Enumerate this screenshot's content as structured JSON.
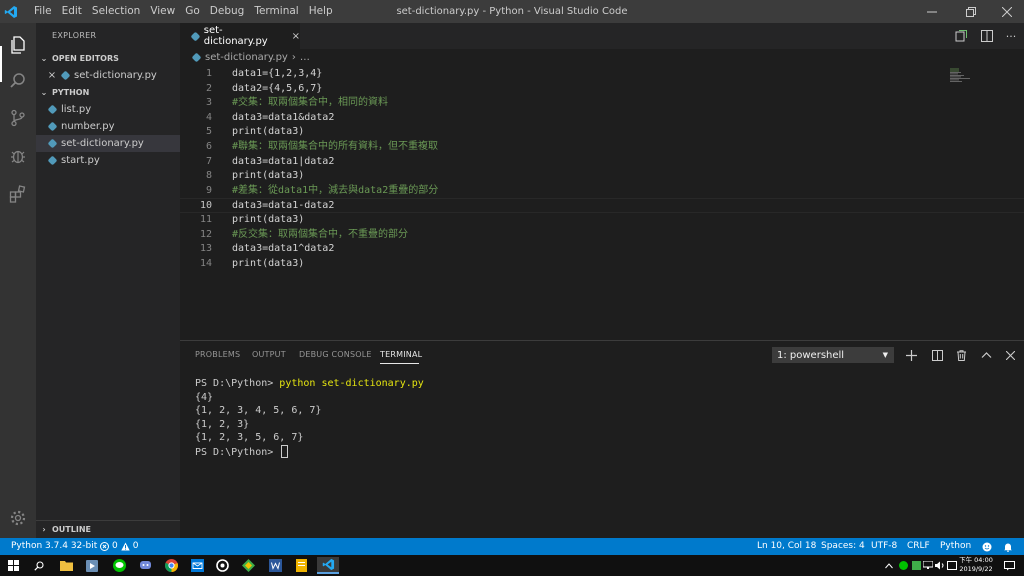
{
  "titlebar": {
    "menu": [
      "File",
      "Edit",
      "Selection",
      "View",
      "Go",
      "Debug",
      "Terminal",
      "Help"
    ],
    "title": "set-dictionary.py - Python - Visual Studio Code"
  },
  "sidebar": {
    "title": "EXPLORER",
    "open_editors": {
      "label": "OPEN EDITORS",
      "items": [
        {
          "close": "×",
          "name": "set-dictionary.py"
        }
      ]
    },
    "folder": {
      "label": "PYTHON",
      "items": [
        "list.py",
        "number.py",
        "set-dictionary.py",
        "start.py"
      ]
    },
    "outline": "OUTLINE"
  },
  "editor": {
    "tab_label": "set-dictionary.py",
    "tab_close": "×",
    "breadcrumb_file": "set-dictionary.py",
    "breadcrumb_tail": "…",
    "current_line": 10,
    "lines": [
      {
        "no": "1",
        "text": "data1={1,2,3,4}",
        "kind": "code"
      },
      {
        "no": "2",
        "text": "data2={4,5,6,7}",
        "kind": "code"
      },
      {
        "no": "3",
        "text": "#交集：取兩個集合中，相同的資料",
        "kind": "comment"
      },
      {
        "no": "4",
        "text": "data3=data1&data2",
        "kind": "code"
      },
      {
        "no": "5",
        "text": "print(data3)",
        "kind": "code"
      },
      {
        "no": "6",
        "text": "#聯集：取兩個集合中的所有資料，但不重複取",
        "kind": "comment"
      },
      {
        "no": "7",
        "text": "data3=data1|data2",
        "kind": "code"
      },
      {
        "no": "8",
        "text": "print(data3)",
        "kind": "code"
      },
      {
        "no": "9",
        "text": "#差集：從data1中，減去與data2重疊的部分",
        "kind": "comment"
      },
      {
        "no": "10",
        "text": "data3=data1-data2",
        "kind": "code"
      },
      {
        "no": "11",
        "text": "print(data3)",
        "kind": "code"
      },
      {
        "no": "12",
        "text": "#反交集：取兩個集合中，不重疊的部分",
        "kind": "comment"
      },
      {
        "no": "13",
        "text": "data3=data1^data2",
        "kind": "code"
      },
      {
        "no": "14",
        "text": "print(data3)",
        "kind": "code"
      }
    ]
  },
  "panel": {
    "tabs": [
      "PROBLEMS",
      "OUTPUT",
      "DEBUG CONSOLE",
      "TERMINAL"
    ],
    "active_tab": "TERMINAL",
    "terminal_select": "1: powershell",
    "terminal": {
      "prompt": "PS D:\\Python> ",
      "command": "python set-dictionary.py",
      "output": [
        "{4}",
        "{1, 2, 3, 4, 5, 6, 7}",
        "{1, 2, 3}",
        "{1, 2, 3, 5, 6, 7}"
      ],
      "final_prompt": "PS D:\\Python> "
    }
  },
  "statusbar": {
    "interpreter": "Python 3.7.4 32-bit",
    "errors": "0",
    "warnings": "0",
    "position": "Ln 10, Col 18",
    "spaces": "Spaces: 4",
    "encoding": "UTF-8",
    "eol": "CRLF",
    "language": "Python"
  },
  "taskbar": {
    "clock_period_time": "下午 04:00",
    "clock_date": "2019/9/22"
  },
  "colors": {
    "accent": "#007acc",
    "comment": "#6a9955",
    "terminal_command": "#e5e510"
  },
  "icons": [
    "vscode-logo-icon",
    "files-icon",
    "search-icon",
    "source-control-icon",
    "debug-icon",
    "extensions-icon",
    "gear-icon",
    "python-file-icon",
    "windows-start-icon"
  ]
}
